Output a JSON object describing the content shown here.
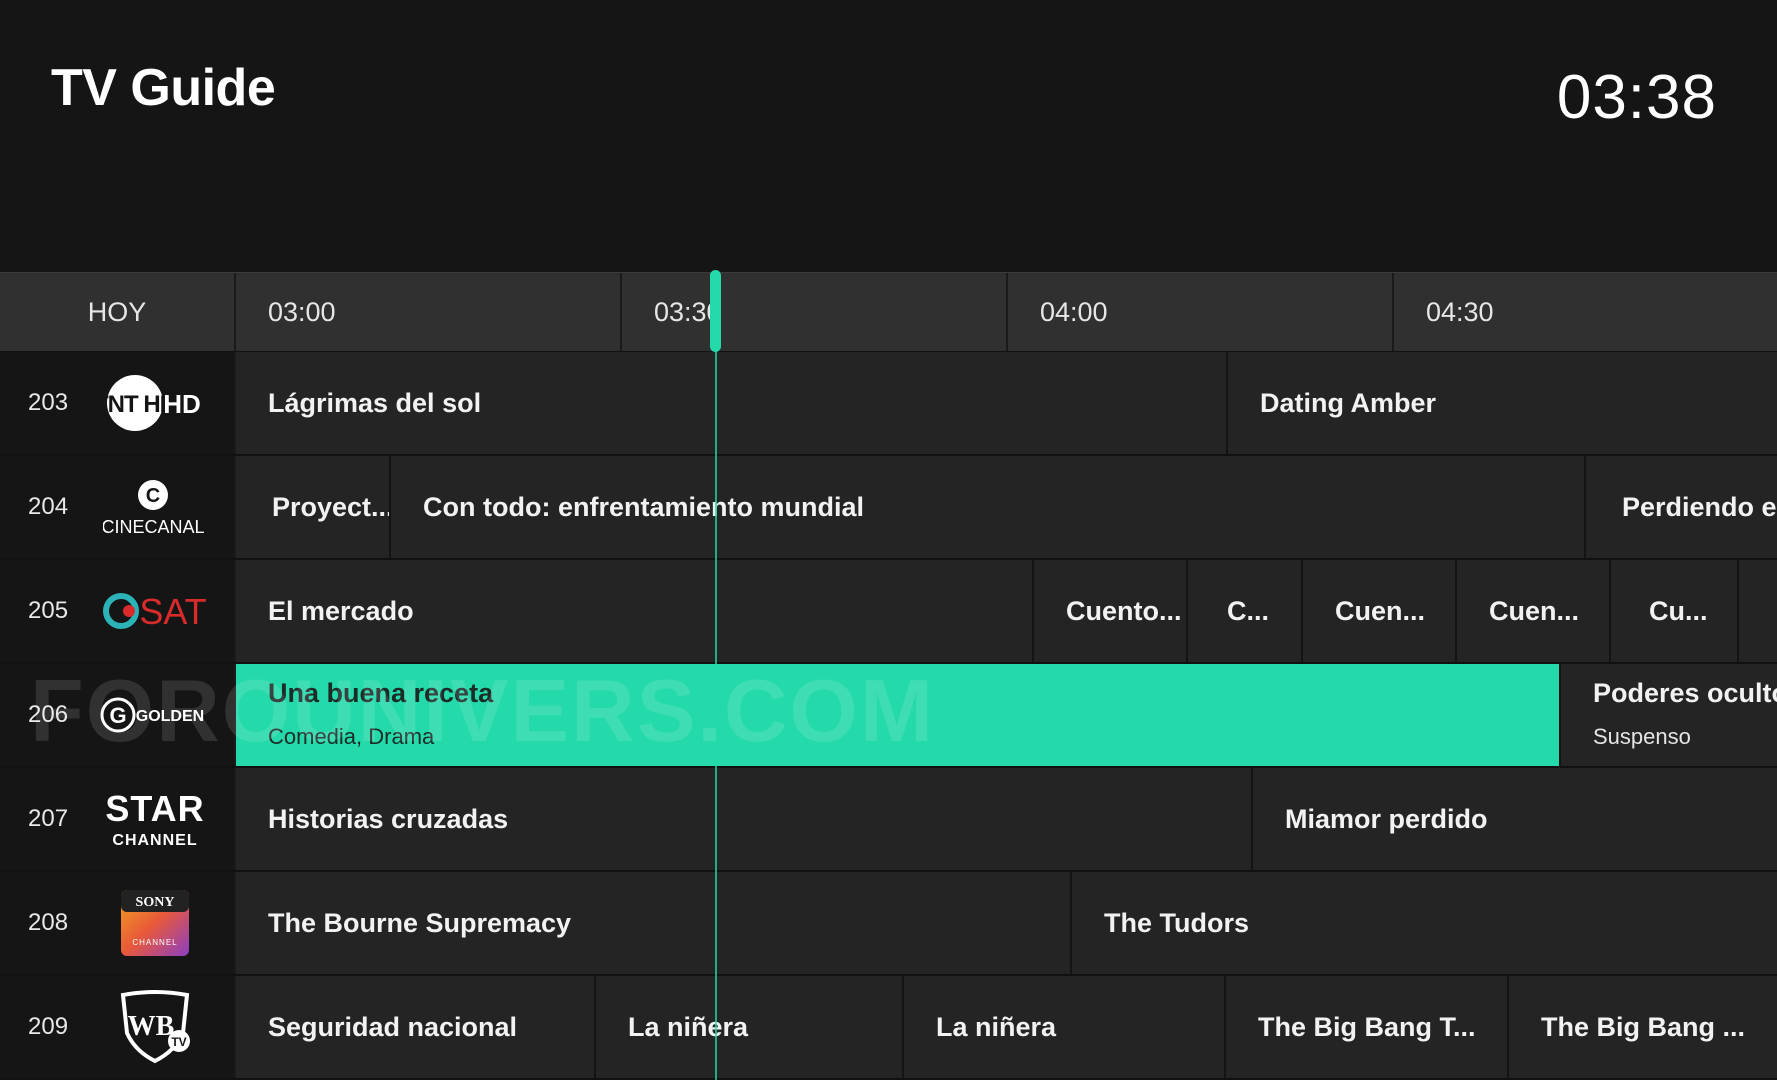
{
  "header": {
    "title": "TV Guide",
    "clock": "03:38"
  },
  "timeline": {
    "day": "HOY",
    "slots": [
      "03:00",
      "03:30",
      "04:00",
      "04:30"
    ]
  },
  "accent_color": "#24d9aa",
  "watermark": "FOROUNIVERS.COM",
  "channels": [
    {
      "number": "203",
      "logo": {
        "icon": "tnt-hd-logo",
        "text": "TNT HD"
      },
      "programs": [
        {
          "title": "Lágrimas del sol"
        },
        {
          "title": "Dating Amber"
        }
      ]
    },
    {
      "number": "204",
      "logo": {
        "icon": "cinecanal-logo",
        "text": "CINECANAL"
      },
      "programs": [
        {
          "title": "Proyect..."
        },
        {
          "title": "Con todo: enfrentamiento mundial"
        },
        {
          "title": "Perdiendo el"
        }
      ]
    },
    {
      "number": "205",
      "logo": {
        "icon": "csat-logo",
        "text": "SAT"
      },
      "programs": [
        {
          "title": "El mercado"
        },
        {
          "title": "Cuento..."
        },
        {
          "title": "C..."
        },
        {
          "title": "Cuen..."
        },
        {
          "title": "Cuen..."
        },
        {
          "title": "Cu..."
        }
      ]
    },
    {
      "number": "206",
      "logo": {
        "icon": "golden-logo",
        "text": "GOLDEN"
      },
      "programs": [
        {
          "title": "Una buena receta",
          "genre": "Comedia, Drama",
          "selected": true
        },
        {
          "title": "Poderes ocultos",
          "genre": "Suspenso"
        }
      ]
    },
    {
      "number": "207",
      "logo": {
        "icon": "star-channel-logo",
        "text": "STAR",
        "subtext": "CHANNEL"
      },
      "programs": [
        {
          "title": "Historias cruzadas"
        },
        {
          "title": "Miamor perdido"
        }
      ]
    },
    {
      "number": "208",
      "logo": {
        "icon": "sony-channel-logo",
        "text": "SONY",
        "subtext": "CHANNEL"
      },
      "programs": [
        {
          "title": "The Bourne Supremacy"
        },
        {
          "title": "The Tudors"
        }
      ]
    },
    {
      "number": "209",
      "logo": {
        "icon": "warner-tv-logo",
        "text": "WB",
        "subtext": "TV"
      },
      "programs": [
        {
          "title": "Seguridad nacional"
        },
        {
          "title": "La niñera"
        },
        {
          "title": "La niñera"
        },
        {
          "title": "The Big Bang T..."
        },
        {
          "title": "The Big Bang ..."
        }
      ]
    }
  ]
}
